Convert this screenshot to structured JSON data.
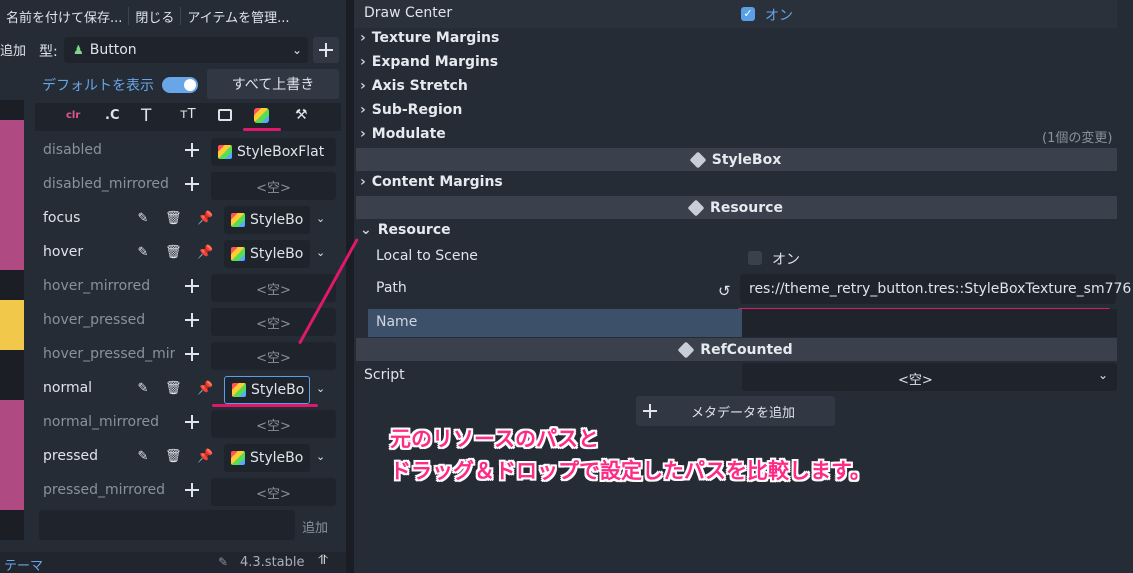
{
  "menu": {
    "save_as": "名前を付けて保存...",
    "close": "閉じる",
    "manage": "アイテムを管理..."
  },
  "toolbar": {
    "add": "追加",
    "type_label": "型:",
    "type_value": "Button"
  },
  "options": {
    "show_default": "デフォルトを表示",
    "override_all": "すべて上書き"
  },
  "tabs": [
    "clr",
    ".C"
  ],
  "rows": [
    {
      "name": "disabled",
      "value": "StyleBoxFlat",
      "set": "flat"
    },
    {
      "name": "disabled_mirrored",
      "value": "<空>",
      "set": "empty"
    },
    {
      "name": "focus",
      "value": "StyleBo",
      "set": "tex"
    },
    {
      "name": "hover",
      "value": "StyleBo",
      "set": "tex"
    },
    {
      "name": "hover_mirrored",
      "value": "<空>",
      "set": "empty"
    },
    {
      "name": "hover_pressed",
      "value": "<空>",
      "set": "empty"
    },
    {
      "name": "hover_pressed_mirr",
      "value": "<空>",
      "set": "empty"
    },
    {
      "name": "normal",
      "value": "StyleBo",
      "set": "tex-selected"
    },
    {
      "name": "normal_mirrored",
      "value": "<空>",
      "set": "empty"
    },
    {
      "name": "pressed",
      "value": "StyleBo",
      "set": "tex"
    },
    {
      "name": "pressed_mirrored",
      "value": "<空>",
      "set": "empty"
    }
  ],
  "add_bottom": "追加",
  "bottom_bar": {
    "theme": "テーマ",
    "version": "4.3.stable"
  },
  "inspector": {
    "draw_center": {
      "label": "Draw Center",
      "value": "オン"
    },
    "sections": [
      "Texture Margins",
      "Expand Margins",
      "Axis Stretch",
      "Sub-Region",
      "Modulate"
    ],
    "modulate_changes": "(1個の変更)",
    "stylebox_header": "StyleBox",
    "content_margins": "Content Margins",
    "resource_header": "Resource",
    "resource_group": "Resource",
    "local_to_scene": {
      "label": "Local to Scene",
      "value": "オン"
    },
    "path": {
      "label": "Path",
      "value": "res://theme_retry_button.tres::StyleBoxTexture_sm776"
    },
    "name": {
      "label": "Name"
    },
    "refcounted_header": "RefCounted",
    "script": {
      "label": "Script",
      "value": "<空>"
    },
    "add_metadata": "メタデータを追加"
  },
  "annotation": {
    "line1": "元のリソースのパスと",
    "line2": "ドラッグ＆ドロップで設定したパスを比較します。"
  },
  "colors": {
    "accent": "#5aa0e6",
    "annotation": "#e0186c",
    "bg_panel": "#262c36",
    "bg_field": "#1f242c"
  }
}
